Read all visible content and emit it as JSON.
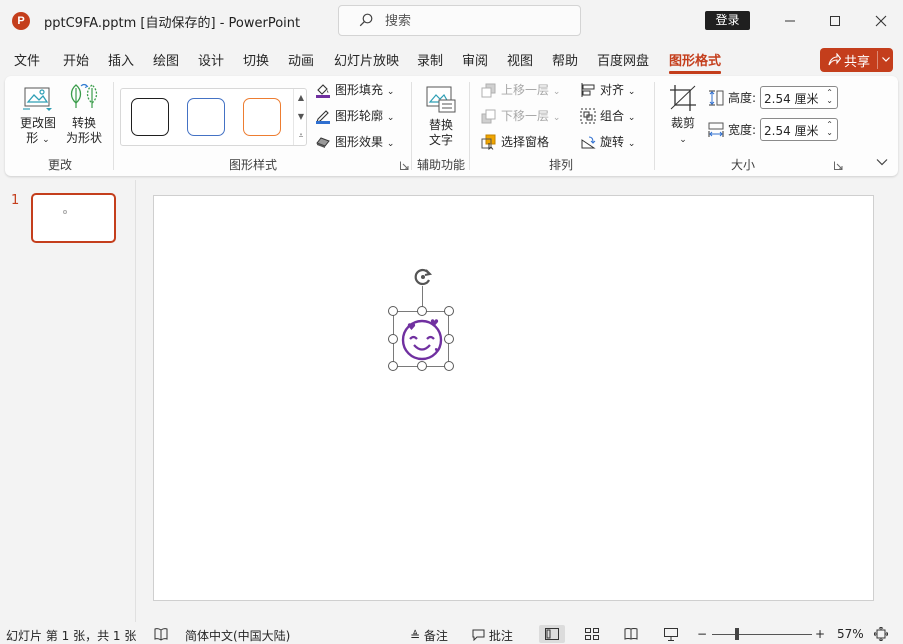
{
  "titlebar": {
    "app_icon": "P",
    "document_title": "pptC9FA.pptm [自动保存的]  -  PowerPoint",
    "search_placeholder": "搜索",
    "login_label": "登录"
  },
  "menu": {
    "tabs": [
      {
        "label": "文件"
      },
      {
        "label": "开始"
      },
      {
        "label": "插入"
      },
      {
        "label": "绘图"
      },
      {
        "label": "设计"
      },
      {
        "label": "切换"
      },
      {
        "label": "动画"
      },
      {
        "label": "幻灯片放映"
      },
      {
        "label": "录制"
      },
      {
        "label": "审阅"
      },
      {
        "label": "视图"
      },
      {
        "label": "帮助"
      },
      {
        "label": "百度网盘"
      },
      {
        "label": "图形格式",
        "active": true
      }
    ],
    "share_label": "共享"
  },
  "ribbon": {
    "change_group": {
      "label": "更改",
      "change_graphic_label": "更改图形",
      "change_graphic_label_line1": "更改图",
      "change_graphic_label_line2": "形",
      "convert_label_line1": "转换",
      "convert_label_line2": "为形状"
    },
    "styles_group": {
      "label": "图形样式",
      "style_colors": [
        "#1f1f1f",
        "#4472c4",
        "#ed7d31"
      ],
      "fill_label": "图形填充",
      "outline_label": "图形轮廓",
      "effects_label": "图形效果"
    },
    "accessibility_group": {
      "label": "辅助功能",
      "alt_text_line1": "替换",
      "alt_text_line2": "文字"
    },
    "arrange_group": {
      "label": "排列",
      "bring_forward_label": "上移一层",
      "send_backward_label": "下移一层",
      "selection_pane_label": "选择窗格",
      "align_label": "对齐",
      "group_label": "组合",
      "rotate_label": "旋转"
    },
    "size_group": {
      "label": "大小",
      "crop_label": "裁剪",
      "height_label": "高度:",
      "height_value": "2.54 厘米",
      "width_label": "宽度:",
      "width_value": "2.54 厘米"
    }
  },
  "thumbnails": {
    "slide_number": "1"
  },
  "statusbar": {
    "slide_info": "幻灯片 第 1 张，共 1 张",
    "language": "简体中文(中国大陆)",
    "notes_label": "备注",
    "comments_label": "批注",
    "zoom_minus": "−",
    "zoom_plus": "+",
    "zoom_percent": "57%",
    "zoom_level": 0.57
  },
  "colors": {
    "accent": "#c43e1c",
    "emoji": "#7030a0"
  }
}
